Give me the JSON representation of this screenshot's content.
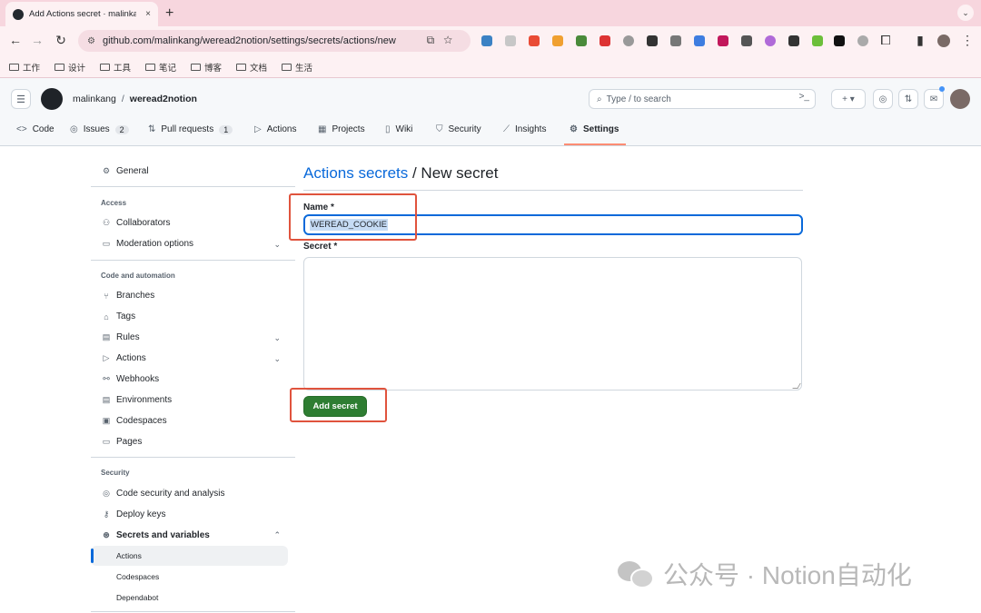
{
  "browser": {
    "tab_title": "Add Actions secret · malinkang",
    "tab_close": "×",
    "new_tab": "+",
    "tab_menu": "⌄",
    "url": "github.com/malinkang/weread2notion/settings/secrets/actions/new",
    "bookmarks": [
      "工作",
      "设计",
      "工具",
      "笔记",
      "博客",
      "文档",
      "生活"
    ]
  },
  "github": {
    "owner": "malinkang",
    "slash": "/",
    "repo": "weread2notion",
    "search_placeholder": "Type / to search",
    "repo_tabs": [
      {
        "label": "Code",
        "icon": "code-icon"
      },
      {
        "label": "Issues",
        "count": "2",
        "icon": "issue-icon"
      },
      {
        "label": "Pull requests",
        "count": "1",
        "icon": "pull-request-icon"
      },
      {
        "label": "Actions",
        "icon": "play-icon"
      },
      {
        "label": "Projects",
        "icon": "table-icon"
      },
      {
        "label": "Wiki",
        "icon": "book-icon"
      },
      {
        "label": "Security",
        "icon": "shield-icon"
      },
      {
        "label": "Insights",
        "icon": "graph-icon"
      },
      {
        "label": "Settings",
        "icon": "gear-icon"
      }
    ]
  },
  "sidebar": {
    "general": "General",
    "access_heading": "Access",
    "collaborators": "Collaborators",
    "moderation": "Moderation options",
    "code_heading": "Code and automation",
    "branches": "Branches",
    "tags": "Tags",
    "rules": "Rules",
    "actions": "Actions",
    "webhooks": "Webhooks",
    "environments": "Environments",
    "codespaces": "Codespaces",
    "pages": "Pages",
    "security_heading": "Security",
    "code_security": "Code security and analysis",
    "deploy_keys": "Deploy keys",
    "secrets_vars": "Secrets and variables",
    "sub_actions": "Actions",
    "sub_codespaces": "Codespaces",
    "sub_dependabot": "Dependabot"
  },
  "main": {
    "title_link": "Actions secrets",
    "title_rest": " / New secret",
    "name_label": "Name *",
    "name_value": "WEREAD_COOKIE",
    "secret_label": "Secret *",
    "secret_value": "",
    "add_button": "Add secret"
  },
  "watermark": {
    "text": "公众号 · Notion自动化"
  },
  "colors": {
    "accent": "#0969da",
    "button_green": "#2e7d32",
    "highlight_red": "#e0533d"
  }
}
